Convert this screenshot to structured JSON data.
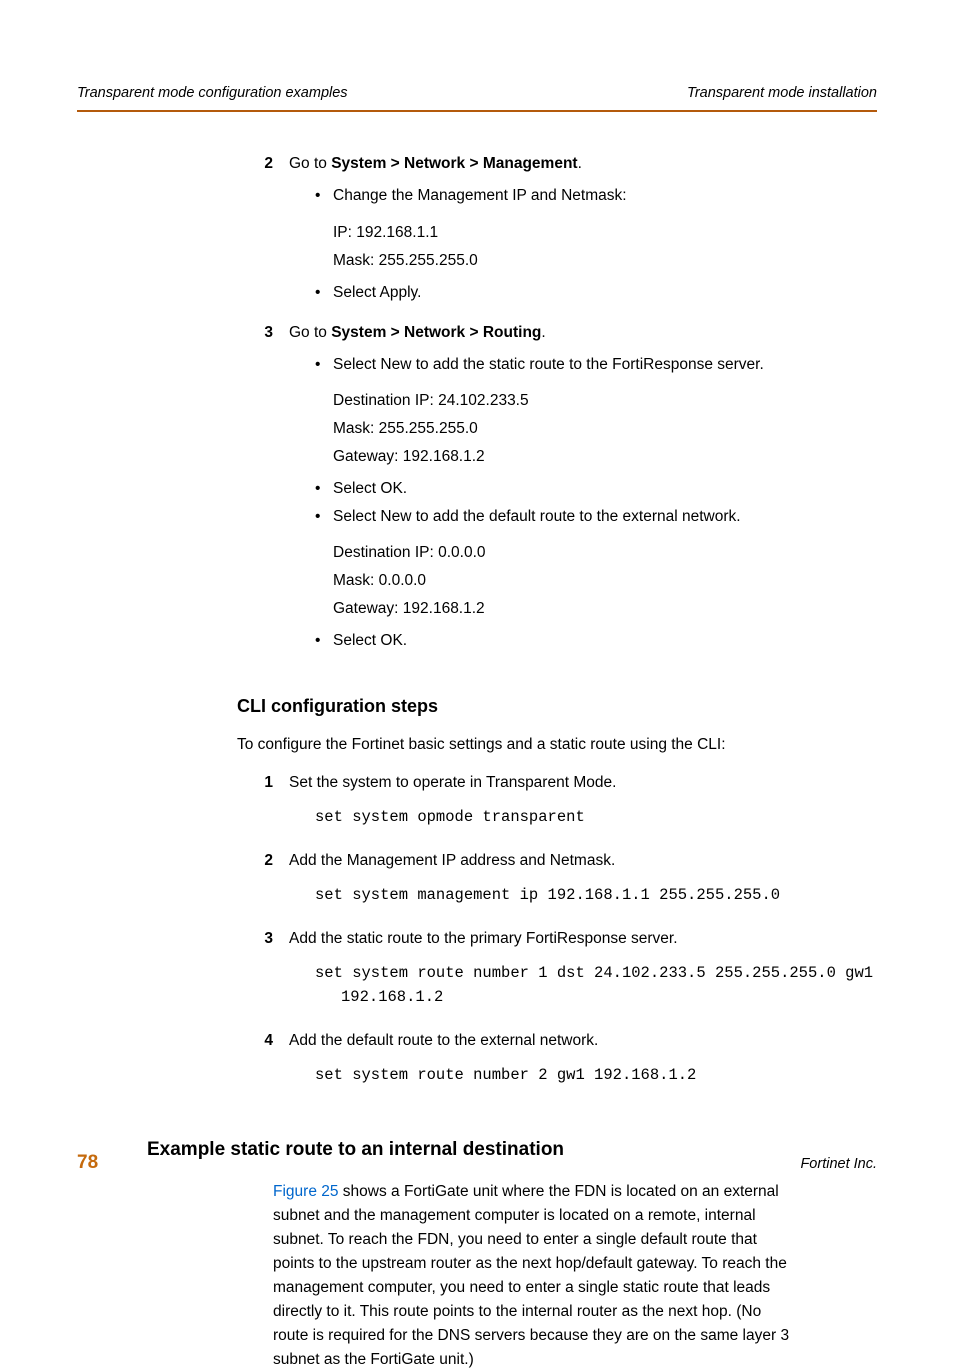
{
  "header": {
    "left": "Transparent mode configuration examples",
    "right": "Transparent mode installation"
  },
  "step2": {
    "num": "2",
    "goto_prefix": "Go to ",
    "goto_path": "System > Network > Management",
    "goto_suffix": ".",
    "b1": "Change the Management IP and Netmask:",
    "b1a": "IP: 192.168.1.1",
    "b1b": "Mask: 255.255.255.0",
    "b2": "Select Apply."
  },
  "step3": {
    "num": "3",
    "goto_prefix": "Go to ",
    "goto_path": "System > Network > Routing",
    "goto_suffix": ".",
    "b1": "Select New to add the static route to the FortiResponse server.",
    "b1a": "Destination IP: 24.102.233.5",
    "b1b": "Mask: 255.255.255.0",
    "b1c": "Gateway: 192.168.1.2",
    "b2": "Select OK.",
    "b3": "Select New to add the default route to the external network.",
    "b3a": "Destination IP: 0.0.0.0",
    "b3b": "Mask: 0.0.0.0",
    "b3c": "Gateway: 192.168.1.2",
    "b4": "Select OK."
  },
  "cli": {
    "heading": "CLI configuration steps",
    "intro": "To configure the Fortinet basic settings and a static route using the CLI:",
    "s1num": "1",
    "s1": "Set the system to operate in Transparent Mode.",
    "c1": "set system opmode transparent",
    "s2num": "2",
    "s2": "Add the Management IP address and Netmask.",
    "c2": "set system management ip 192.168.1.1 255.255.255.0",
    "s3num": "3",
    "s3": "Add the static route to the primary FortiResponse server.",
    "c3a": "set system route number 1 dst 24.102.233.5 255.255.255.0 gw1",
    "c3b": "192.168.1.2",
    "s4num": "4",
    "s4": "Add the default route to the external network.",
    "c4": "set system route number 2 gw1 192.168.1.2"
  },
  "example": {
    "heading": "Example static route to an internal destination",
    "figref": "Figure 25",
    "para": " shows a FortiGate unit where the FDN is located on an external subnet and the management computer is located on a remote, internal subnet. To reach the FDN, you need to enter a single default route that points to the upstream router as the next hop/default gateway. To reach the management computer, you need to enter a single static route that leads directly to it. This route points to the internal router as the next hop. (No route is required for the DNS servers because they are on the same layer 3 subnet as the FortiGate unit.)"
  },
  "footer": {
    "pagenum": "78",
    "company": "Fortinet Inc."
  }
}
